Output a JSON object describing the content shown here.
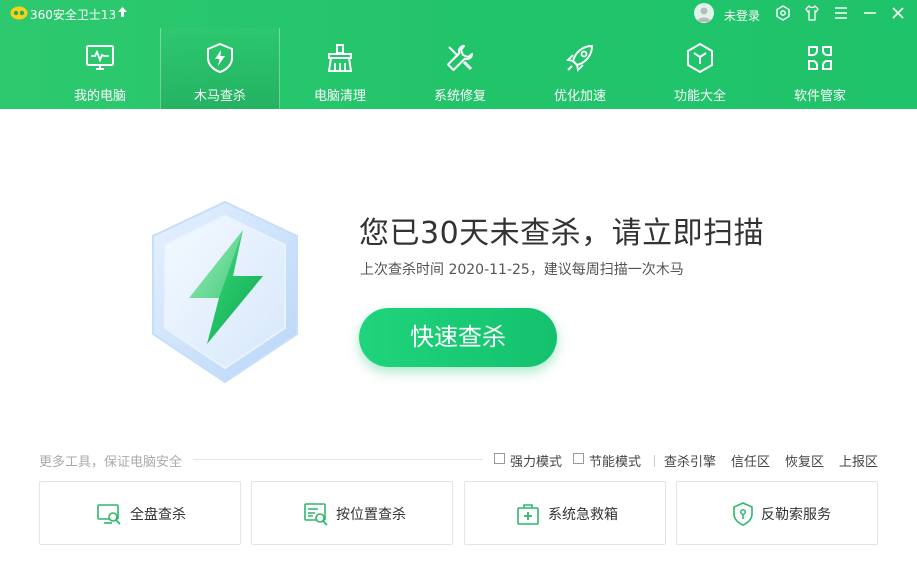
{
  "app": {
    "title": "360安全卫士13"
  },
  "titlebar": {
    "login_text": "未登录",
    "icons": [
      "skin-icon",
      "shirt-icon",
      "menu-icon",
      "minimize-icon",
      "close-icon"
    ]
  },
  "nav": {
    "items": [
      {
        "label": "我的电脑",
        "icon": "computer-icon"
      },
      {
        "label": "木马查杀",
        "icon": "shield-lightning-icon",
        "active": true
      },
      {
        "label": "电脑清理",
        "icon": "broom-icon"
      },
      {
        "label": "系统修复",
        "icon": "wrench-icon"
      },
      {
        "label": "优化加速",
        "icon": "rocket-icon"
      },
      {
        "label": "功能大全",
        "icon": "hexagon-icon"
      },
      {
        "label": "软件管家",
        "icon": "apps-icon"
      }
    ]
  },
  "main": {
    "headline": "您已30天未查杀，请立即扫描",
    "subline": "上次查杀时间 2020-11-25，建议每周扫描一次木马",
    "scan_button": "快速查杀"
  },
  "tools": {
    "label": "更多工具，保证电脑安全",
    "options": [
      {
        "label": "强力模式",
        "checked": false
      },
      {
        "label": "节能模式",
        "checked": false
      }
    ],
    "links": [
      "查杀引擎",
      "信任区",
      "恢复区",
      "上报区"
    ],
    "cards": [
      {
        "label": "全盘查杀",
        "icon": "full-scan-icon"
      },
      {
        "label": "按位置查杀",
        "icon": "location-scan-icon"
      },
      {
        "label": "系统急救箱",
        "icon": "first-aid-icon"
      },
      {
        "label": "反勒索服务",
        "icon": "anti-ransom-shield-icon"
      }
    ]
  },
  "colors": {
    "brand_green": "#22c46a",
    "button_green": "#1fd47c"
  }
}
